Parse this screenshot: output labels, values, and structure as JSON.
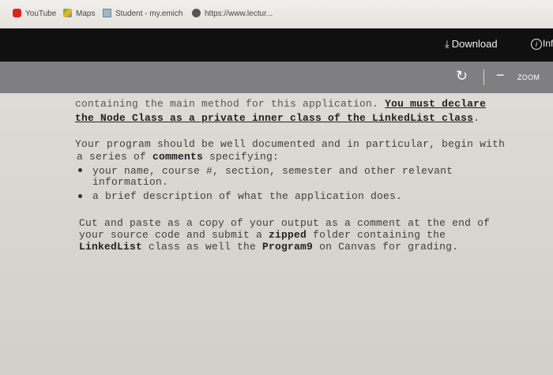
{
  "bookmarks": [
    {
      "icon": "youtube-icon",
      "label": "YouTube"
    },
    {
      "icon": "maps-icon",
      "label": "Maps"
    },
    {
      "icon": "student-icon",
      "label": "Student - my.emich"
    },
    {
      "icon": "web-icon",
      "label": "https://www.lectur..."
    }
  ],
  "viewer": {
    "download_label": "Download",
    "info_label": "Inf",
    "zoom_label": "ZOOM"
  },
  "document": {
    "line1": "containing the main method for this application. ",
    "line1_emph": "You must declare",
    "line2_emph": "the Node Class as a private inner class of the LinkedList class",
    "line2_end": ".",
    "para2_line1": "Your program should be well documented and in particular, begin with",
    "para2_line2_pre": "a series of ",
    "para2_line2_bold": "comments",
    "para2_line2_post": " specifying:",
    "bullet1_line1": "your name, course #, section, semester and other relevant",
    "bullet1_line2": "information.",
    "bullet2": "a brief description of what the application does.",
    "para3_line1": "Cut and paste as a copy of your output as a comment at the end of",
    "para3_line2_pre": "your source code and submit a ",
    "para3_line2_bold": "zipped",
    "para3_line2_post": " folder containing the",
    "para3_line3_bold1": "LinkedList",
    "para3_line3_mid": " class as well the ",
    "para3_line3_bold2": "Program9",
    "para3_line3_post": " on Canvas for grading."
  }
}
